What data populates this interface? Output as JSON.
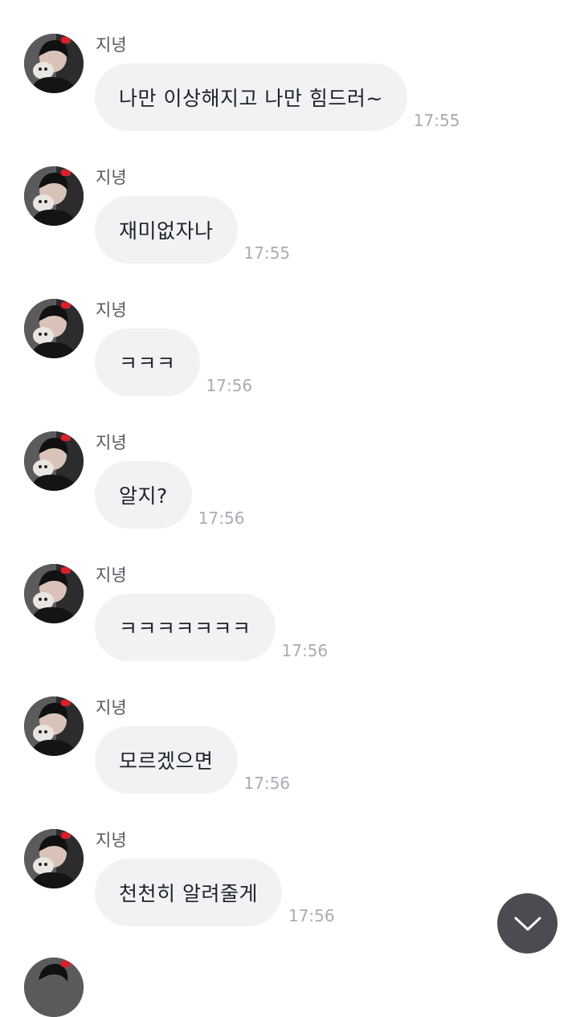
{
  "chat": {
    "messages": [
      {
        "sender": "지녕",
        "text": "나만 이상해지고 나만 힘드러~",
        "time": "17:55"
      },
      {
        "sender": "지녕",
        "text": "재미없자나",
        "time": "17:55"
      },
      {
        "sender": "지녕",
        "text": "ㅋㅋㅋ",
        "time": "17:56"
      },
      {
        "sender": "지녕",
        "text": "알지?",
        "time": "17:56"
      },
      {
        "sender": "지녕",
        "text": "ㅋㅋㅋㅋㅋㅋㅋ",
        "time": "17:56"
      },
      {
        "sender": "지녕",
        "text": "모르겠으면",
        "time": "17:56"
      },
      {
        "sender": "지녕",
        "text": "천천히 알려줄게",
        "time": "17:56"
      }
    ]
  },
  "icons": {
    "avatar": "profile-photo",
    "scroll_down": "chevron-down-icon"
  },
  "colors": {
    "bubble": "#f1f2f4",
    "message_text": "#1f2328",
    "sender_text": "#555a60",
    "time_text": "#a8acb2",
    "scroll_button": "#4a4c51"
  }
}
